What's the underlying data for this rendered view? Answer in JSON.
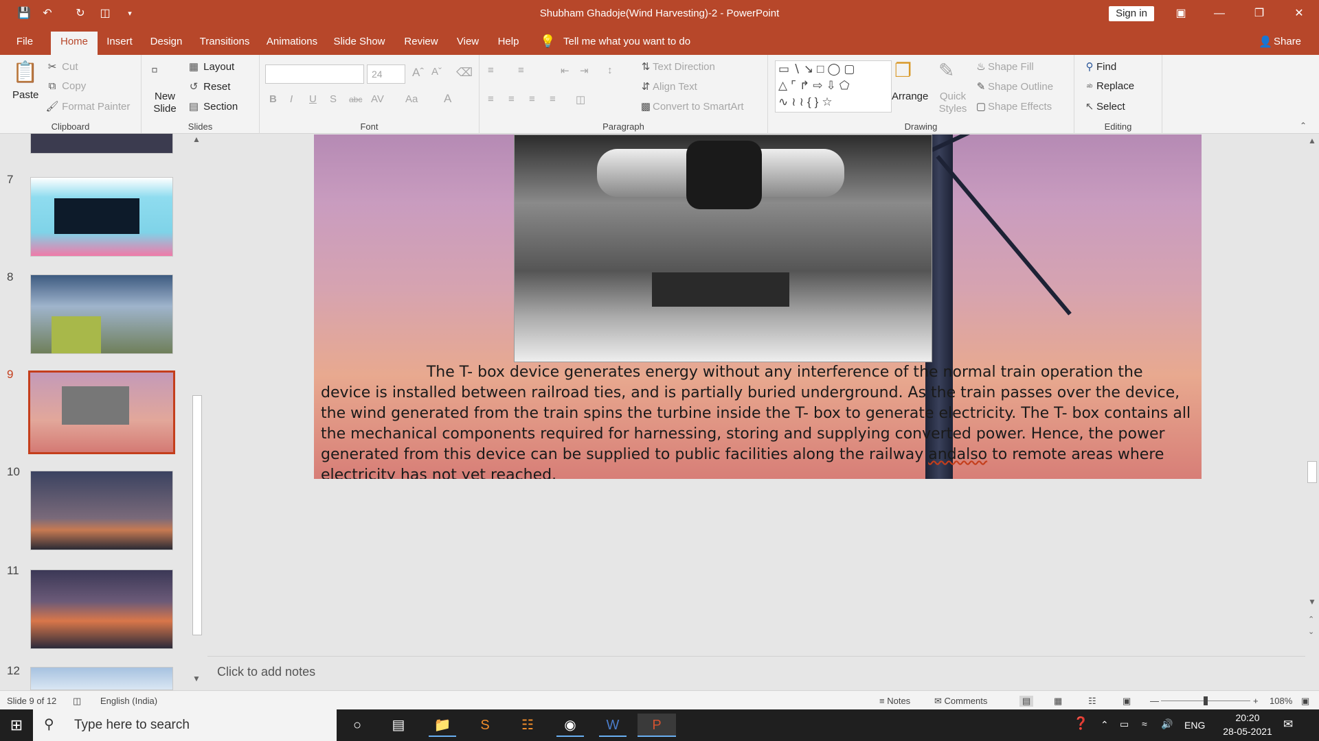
{
  "titlebar": {
    "title": "Shubham Ghadoje(Wind Harvesting)-2  -  PowerPoint",
    "sign_in": "Sign in"
  },
  "tabs": [
    "File",
    "Home",
    "Insert",
    "Design",
    "Transitions",
    "Animations",
    "Slide Show",
    "Review",
    "View",
    "Help"
  ],
  "tell_me": "Tell me what you want to do",
  "share": "Share",
  "ribbon": {
    "clipboard": {
      "paste": "Paste",
      "cut": "Cut",
      "copy": "Copy",
      "format_painter": "Format Painter",
      "label": "Clipboard"
    },
    "slides": {
      "new_slide": "New Slide",
      "layout": "Layout",
      "reset": "Reset",
      "section": "Section",
      "label": "Slides"
    },
    "font": {
      "size": "24",
      "label": "Font"
    },
    "paragraph": {
      "text_direction": "Text Direction",
      "align_text": "Align Text",
      "convert_smartart": "Convert to SmartArt",
      "label": "Paragraph"
    },
    "drawing": {
      "arrange": "Arrange",
      "quick_styles": "Quick Styles",
      "shape_fill": "Shape Fill",
      "shape_outline": "Shape Outline",
      "shape_effects": "Shape Effects",
      "label": "Drawing"
    },
    "editing": {
      "find": "Find",
      "replace": "Replace",
      "select": "Select",
      "label": "Editing"
    }
  },
  "thumbnails": [
    {
      "num": "7",
      "color": "#7fd3e8"
    },
    {
      "num": "8",
      "color": "#7a8fa6"
    },
    {
      "num": "9",
      "color": "#d98a7c",
      "selected": true
    },
    {
      "num": "10",
      "color": "#4a5570"
    },
    {
      "num": "11",
      "color": "#5a4d6a"
    },
    {
      "num": "12",
      "color": "#9ab8d8"
    }
  ],
  "slide": {
    "text_parts": [
      "                      The T- box device generates energy without any interference of the normal train operation the device is installed between railroad ties, and is partially buried underground. As the train passes over the device, the wind generated from the train spins the turbine inside the T- box to generate electricity. The T- box contains all the mechanical components required for harnessing, storing and supplying converted power. Hence, the power generated from this device can be supplied to public facilities along the railway ",
      "andalso",
      " to remote areas where electricity has not yet reached."
    ]
  },
  "notes_placeholder": "Click to add notes",
  "status": {
    "slide": "Slide 9 of 12",
    "language": "English (India)",
    "notes": "Notes",
    "comments": "Comments",
    "zoom": "108%"
  },
  "taskbar": {
    "search": "Type here to search",
    "lang": "ENG",
    "time": "20:20",
    "date": "28-05-2021"
  }
}
